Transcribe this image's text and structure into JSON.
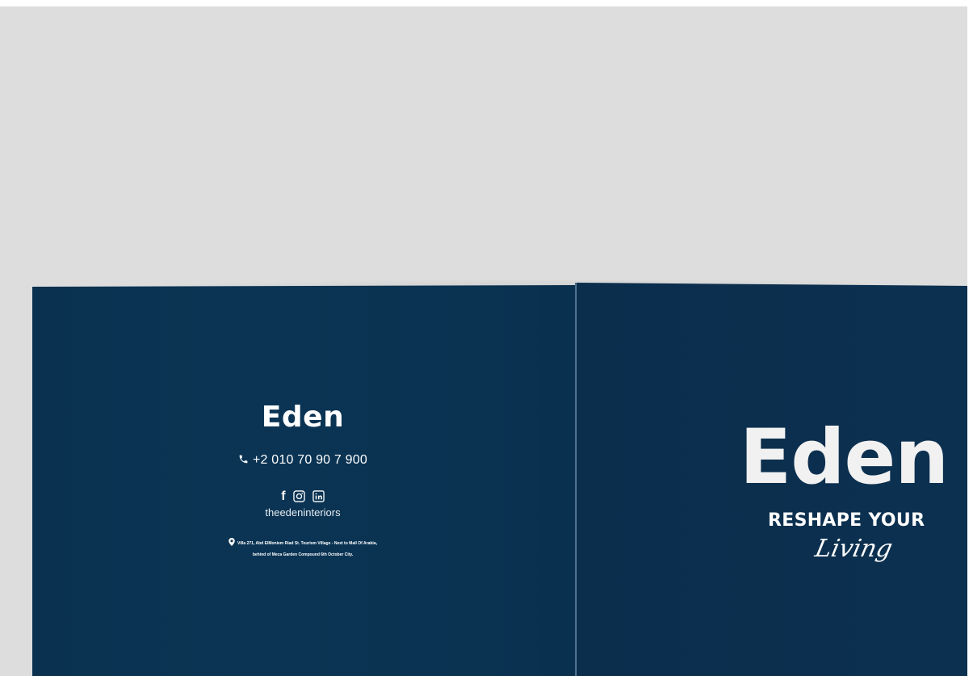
{
  "brochure": {
    "back_cover": {
      "logo": "Eden",
      "phone": "+2 010 70 90 7 900",
      "social": {
        "icons": [
          "facebook-icon",
          "instagram-icon",
          "linkedin-icon"
        ],
        "handle": "theedeninteriors"
      },
      "address_line_1": "Villa 271, Abd ElMoniem Riad St. Tourism Village - Next to Mall Of Arabia,",
      "address_line_2": "behind of Meca Garden Compound 6th October City."
    },
    "front_cover": {
      "logo": "Eden",
      "tagline": "RESHAPE YOUR",
      "script": "Living"
    }
  },
  "colors": {
    "backdrop": "#dddddd",
    "cover_navy": "#0b3253",
    "text": "#ffffff"
  }
}
